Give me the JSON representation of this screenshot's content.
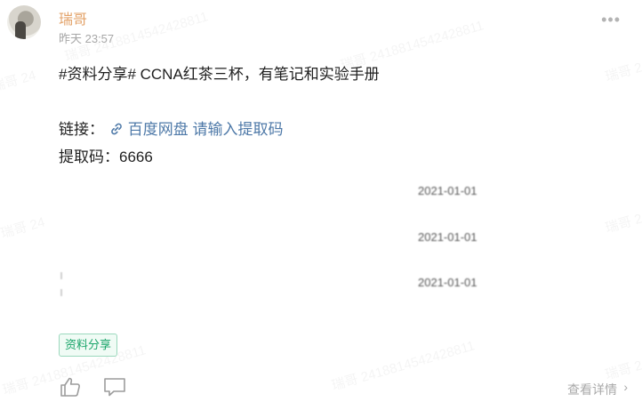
{
  "post": {
    "author": "瑞哥",
    "time": "昨天 23:57",
    "more_icon": "more-horizontal-icon",
    "content": {
      "line1": "#资料分享# CCNA红茶三杯，有笔记和实验手册",
      "link_prefix": "链接：",
      "link_icon": "link-icon",
      "link_text": "百度网盘 请输入提取码",
      "code_line": "提取码：6666"
    },
    "blurred_dates": [
      "2021-01-01",
      "2021-01-01",
      "2021-01-01"
    ],
    "tag": "资料分享",
    "footer": {
      "like_icon": "thumbs-up-icon",
      "comment_icon": "comment-icon",
      "detail_label": "查看详情",
      "detail_icon": "chevron-right-icon"
    }
  },
  "watermark": "瑞哥 2418814542428811"
}
